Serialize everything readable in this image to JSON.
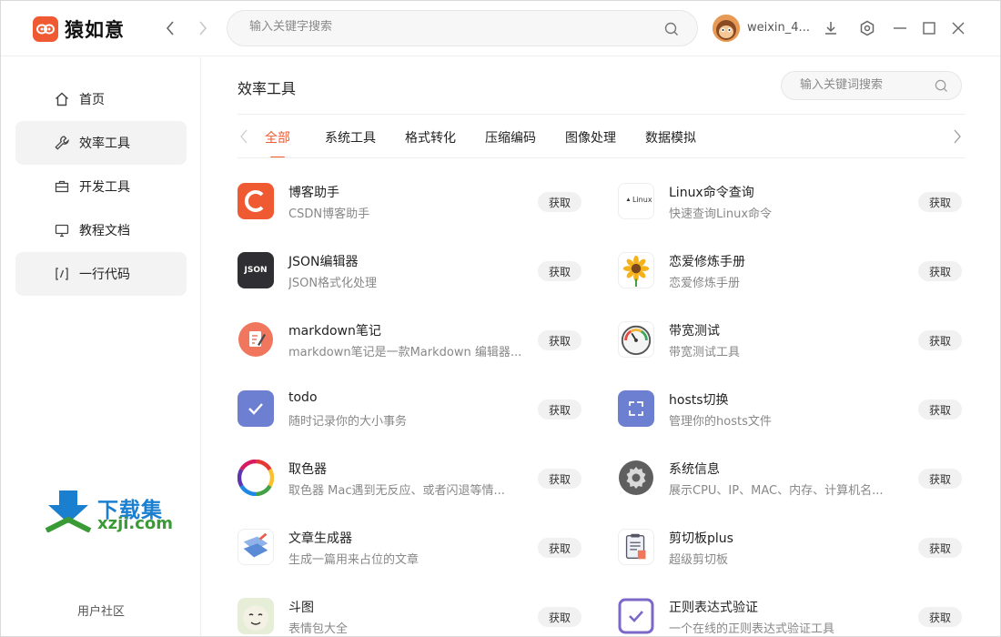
{
  "app": {
    "title": "猿如意",
    "username": "weixin_4..."
  },
  "search_top": {
    "placeholder": "输入关键字搜索"
  },
  "sidebar": {
    "items": [
      {
        "label": "首页",
        "icon": "home-icon"
      },
      {
        "label": "效率工具",
        "icon": "wrench-icon"
      },
      {
        "label": "开发工具",
        "icon": "briefcase-icon"
      },
      {
        "label": "教程文档",
        "icon": "monitor-icon"
      },
      {
        "label": "一行代码",
        "icon": "code-icon"
      }
    ],
    "watermark": {
      "title": "下载集",
      "site": "xzji.com"
    },
    "community": "用户社区"
  },
  "main": {
    "title": "效率工具",
    "search_placeholder": "输入关键词搜索",
    "tabs": [
      "全部",
      "系统工具",
      "格式转化",
      "压缩编码",
      "图像处理",
      "数据模拟"
    ],
    "get_label": "获取",
    "tools": [
      {
        "name": "博客助手",
        "desc": "CSDN博客助手"
      },
      {
        "name": "Linux命令查询",
        "desc": "快速查询Linux命令",
        "icon_text": "Linux"
      },
      {
        "name": "JSON编辑器",
        "desc": "JSON格式化处理",
        "icon_text": "JSON"
      },
      {
        "name": "恋爱修炼手册",
        "desc": "恋爱修炼手册"
      },
      {
        "name": "markdown笔记",
        "desc": "markdown笔记是一款Markdown 编辑器..."
      },
      {
        "name": "带宽测试",
        "desc": "带宽测试工具"
      },
      {
        "name": "todo",
        "desc": "随时记录你的大小事务"
      },
      {
        "name": "hosts切换",
        "desc": "管理你的hosts文件"
      },
      {
        "name": "取色器",
        "desc": "取色器 Mac遇到无反应、或者闪退等情..."
      },
      {
        "name": "系统信息",
        "desc": "展示CPU、IP、MAC、内存、计算机名..."
      },
      {
        "name": "文章生成器",
        "desc": "生成一篇用来占位的文章"
      },
      {
        "name": "剪切板plus",
        "desc": "超级剪切板"
      },
      {
        "name": "斗图",
        "desc": "表情包大全"
      },
      {
        "name": "正则表达式验证",
        "desc": "一个在线的正则表达式验证工具"
      }
    ]
  },
  "colors": {
    "accent": "#f05a33",
    "active_bg": "#f3f3f3"
  }
}
